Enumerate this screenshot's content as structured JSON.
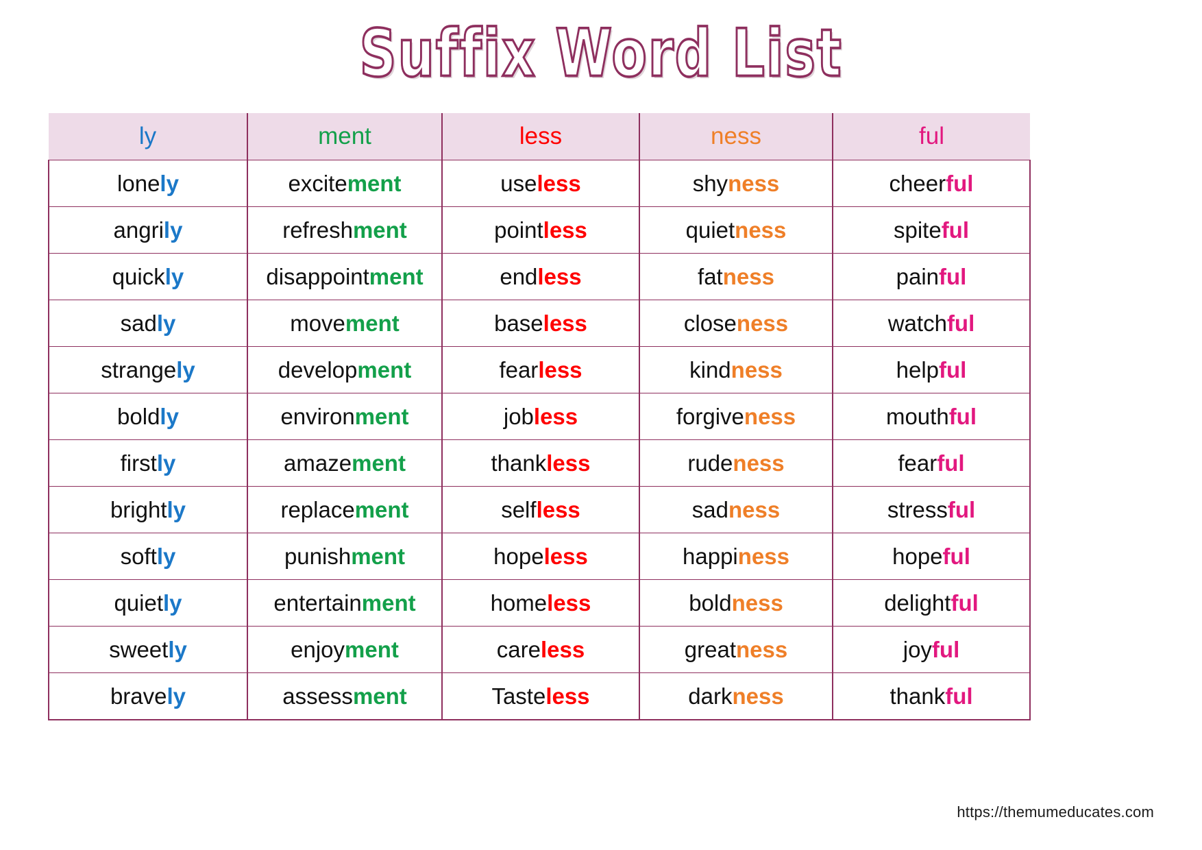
{
  "title": "Suffix Word List",
  "footer": {
    "url": "https://themumeducates.com"
  },
  "colors": {
    "title_stroke": "#8e2f5e",
    "header_bg": "#eedbe8",
    "border": "#8e2f5e",
    "ly": "#1b78c8",
    "ment": "#13a04a",
    "less": "#ff0000",
    "ness": "#ef7f28",
    "ful": "#e2187f",
    "root": "#111111"
  },
  "table": {
    "columns": [
      {
        "key": "ly",
        "label": "ly",
        "color": "#1b78c8"
      },
      {
        "key": "ment",
        "label": "ment",
        "color": "#13a04a"
      },
      {
        "key": "less",
        "label": "less",
        "color": "#ff0000"
      },
      {
        "key": "ness",
        "label": "ness",
        "color": "#ef7f28"
      },
      {
        "key": "ful",
        "label": "ful",
        "color": "#e2187f"
      }
    ],
    "rows": [
      [
        {
          "root": "lone",
          "suffix": "ly"
        },
        {
          "root": "excite",
          "suffix": "ment"
        },
        {
          "root": "use",
          "suffix": "less"
        },
        {
          "root": "shy",
          "suffix": "ness"
        },
        {
          "root": "cheer",
          "suffix": "ful"
        }
      ],
      [
        {
          "root": "angri",
          "suffix": "ly"
        },
        {
          "root": "refresh",
          "suffix": "ment"
        },
        {
          "root": "point",
          "suffix": "less"
        },
        {
          "root": "quiet",
          "suffix": "ness"
        },
        {
          "root": "spite",
          "suffix": "ful"
        }
      ],
      [
        {
          "root": "quick",
          "suffix": "ly"
        },
        {
          "root": "disappoint",
          "suffix": "ment"
        },
        {
          "root": "end",
          "suffix": "less"
        },
        {
          "root": "fat",
          "suffix": "ness"
        },
        {
          "root": "pain",
          "suffix": "ful"
        }
      ],
      [
        {
          "root": "sad",
          "suffix": "ly"
        },
        {
          "root": "move",
          "suffix": "ment"
        },
        {
          "root": "base",
          "suffix": "less"
        },
        {
          "root": "close",
          "suffix": "ness"
        },
        {
          "root": "watch",
          "suffix": "ful"
        }
      ],
      [
        {
          "root": "strange",
          "suffix": "ly"
        },
        {
          "root": "develop",
          "suffix": "ment"
        },
        {
          "root": "fear",
          "suffix": "less"
        },
        {
          "root": "kind",
          "suffix": "ness"
        },
        {
          "root": "help",
          "suffix": "ful"
        }
      ],
      [
        {
          "root": "bold",
          "suffix": "ly"
        },
        {
          "root": "environ",
          "suffix": "ment"
        },
        {
          "root": "job",
          "suffix": "less"
        },
        {
          "root": "forgive",
          "suffix": "ness"
        },
        {
          "root": "mouth",
          "suffix": "ful"
        }
      ],
      [
        {
          "root": "first",
          "suffix": "ly"
        },
        {
          "root": "amaze",
          "suffix": "ment"
        },
        {
          "root": "thank",
          "suffix": "less"
        },
        {
          "root": "rude",
          "suffix": "ness"
        },
        {
          "root": "fear",
          "suffix": "ful"
        }
      ],
      [
        {
          "root": "bright",
          "suffix": "ly"
        },
        {
          "root": "replace",
          "suffix": "ment"
        },
        {
          "root": "self",
          "suffix": "less"
        },
        {
          "root": "sad",
          "suffix": "ness"
        },
        {
          "root": "stress",
          "suffix": "ful"
        }
      ],
      [
        {
          "root": "soft",
          "suffix": "ly"
        },
        {
          "root": "punish",
          "suffix": "ment"
        },
        {
          "root": "hope",
          "suffix": "less"
        },
        {
          "root": "happi",
          "suffix": "ness"
        },
        {
          "root": "hope",
          "suffix": "ful"
        }
      ],
      [
        {
          "root": "quiet",
          "suffix": "ly"
        },
        {
          "root": "entertain",
          "suffix": "ment"
        },
        {
          "root": "home",
          "suffix": "less"
        },
        {
          "root": "bold",
          "suffix": "ness"
        },
        {
          "root": "delight",
          "suffix": "ful"
        }
      ],
      [
        {
          "root": "sweet",
          "suffix": "ly"
        },
        {
          "root": "enjoy",
          "suffix": "ment"
        },
        {
          "root": "care",
          "suffix": "less"
        },
        {
          "root": "great",
          "suffix": "ness"
        },
        {
          "root": "joy",
          "suffix": "ful"
        }
      ],
      [
        {
          "root": "brave",
          "suffix": "ly"
        },
        {
          "root": "assess",
          "suffix": "ment"
        },
        {
          "root": "Taste",
          "suffix": "less"
        },
        {
          "root": "dark",
          "suffix": "ness"
        },
        {
          "root": "thank",
          "suffix": "ful"
        }
      ]
    ]
  }
}
